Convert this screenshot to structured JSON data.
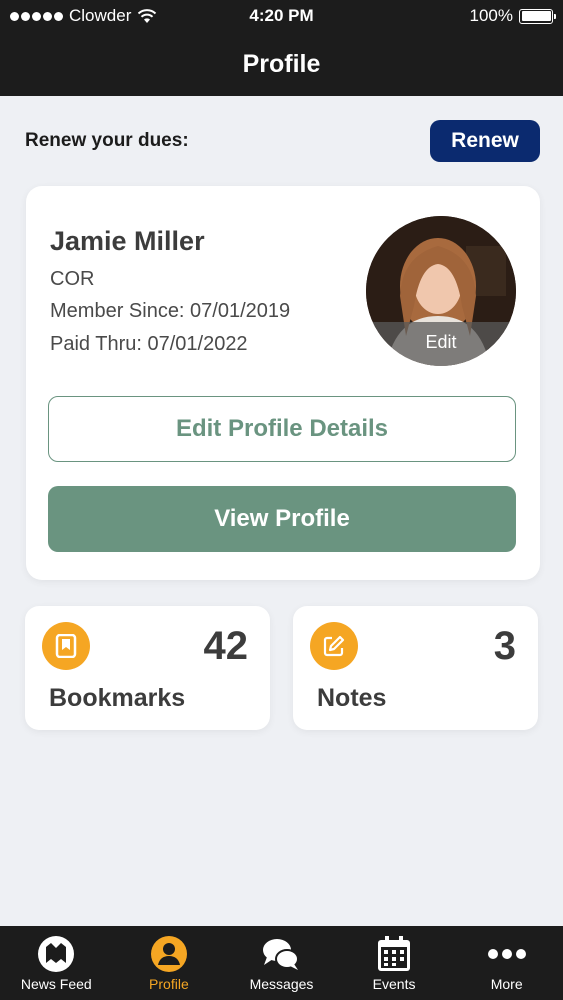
{
  "status_bar": {
    "carrier": "Clowder",
    "time": "4:20 PM",
    "battery": "100%"
  },
  "header": {
    "title": "Profile"
  },
  "renew": {
    "label": "Renew your dues:",
    "button_label": "Renew",
    "button_color": "#0b2a6f"
  },
  "profile": {
    "name": "Jamie Miller",
    "title": "COR",
    "member_since": "Member Since: 07/01/2019",
    "paid_thru": "Paid Thru: 07/01/2022",
    "avatar_edit_label": "Edit",
    "edit_details_label": "Edit Profile Details",
    "view_profile_label": "View Profile",
    "accent_color": "#6a9480"
  },
  "stats": {
    "bookmarks": {
      "count": "42",
      "label": "Bookmarks",
      "icon": "bookmark-icon"
    },
    "notes": {
      "count": "3",
      "label": "Notes",
      "icon": "edit-note-icon"
    },
    "icon_color": "#f5a623"
  },
  "tab_bar": {
    "items": [
      {
        "label": "News Feed",
        "icon": "news-feed-logo-icon",
        "active": false
      },
      {
        "label": "Profile",
        "icon": "user-icon",
        "active": true
      },
      {
        "label": "Messages",
        "icon": "chat-bubbles-icon",
        "active": false
      },
      {
        "label": "Events",
        "icon": "calendar-icon",
        "active": false
      },
      {
        "label": "More",
        "icon": "more-dots-icon",
        "active": false
      }
    ],
    "active_color": "#f5a623"
  }
}
